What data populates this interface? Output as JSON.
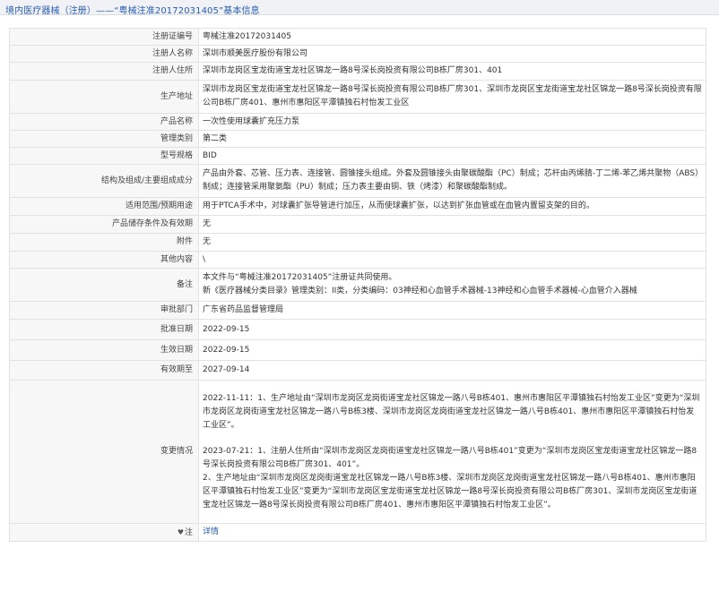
{
  "header": {
    "title": "境内医疗器械（注册）——“粤械注准20172031405”基本信息"
  },
  "rows": [
    {
      "label": "注册证编号",
      "value": "粤械注准20172031405"
    },
    {
      "label": "注册人名称",
      "value": "深圳市顺美医疗股份有限公司"
    },
    {
      "label": "注册人住所",
      "value": "深圳市龙岗区宝龙街道宝龙社区锦龙一路8号深长岗投资有限公司B栋厂房301、401"
    },
    {
      "label": "生产地址",
      "value": "深圳市龙岗区宝龙街道宝龙社区锦龙一路8号深长岗投资有限公司B栋厂房301、深圳市龙岗区宝龙街道宝龙社区锦龙一路8号深长岗投资有限公司B栋厂房401、惠州市惠阳区平潭镇独石村怡发工业区"
    },
    {
      "label": "产品名称",
      "value": "一次性使用球囊扩充压力泵"
    },
    {
      "label": "管理类别",
      "value": "第二类"
    },
    {
      "label": "型号规格",
      "value": "BID"
    },
    {
      "label": "结构及组成/主要组成成分",
      "value": "产品由外套、芯管、压力表、连接管、圆锥接头组成。外套及圆锥接头由聚碳酸酯（PC）制成；芯杆由丙烯腈-丁二烯-苯乙烯共聚物（ABS）制成；连接管采用聚氨酯（PU）制成；压力表主要由铜、铁（烤漆）和聚碳酸酯制成。"
    },
    {
      "label": "适用范围/预期用途",
      "value": "用于PTCA手术中，对球囊扩张导管进行加压，从而使球囊扩张，以达到扩张血管或在血管内置留支架的目的。"
    },
    {
      "label": "产品储存条件及有效期",
      "value": "无"
    },
    {
      "label": "附件",
      "value": "无"
    },
    {
      "label": "其他内容",
      "value": "\\"
    }
  ],
  "remarks": {
    "label": "备注",
    "lines": [
      "本文件与“粤械注准20172031405”注册证共同使用。",
      "新《医疗器械分类目录》管理类别：II类，分类编码：03神经和心血管手术器械-13神经和心血管手术器械-心血管介入器械"
    ]
  },
  "rows2": [
    {
      "label": "审批部门",
      "value": "广东省药品监督管理局"
    },
    {
      "label": "批准日期",
      "value": "2022-09-15"
    },
    {
      "label": "生效日期",
      "value": "2022-09-15"
    },
    {
      "label": "有效期至",
      "value": "2027-09-14"
    }
  ],
  "changes": {
    "label": "变更情况",
    "entries": [
      "2022-11-11：1、生产地址由“深圳市龙岗区龙岗街道宝龙社区锦龙一路八号B栋401、惠州市惠阳区平潭镇独石村怡发工业区”变更为“深圳市龙岗区龙岗街道宝龙社区锦龙一路八号B栋3楼、深圳市龙岗区龙岗街道宝龙社区锦龙一路八号B栋401、惠州市惠阳区平潭镇独石村怡发工业区”。",
      "2023-07-21：1、注册人住所由“深圳市龙岗区龙岗街道宝龙社区锦龙一路八号B栋401”变更为“深圳市龙岗区宝龙街道宝龙社区锦龙一路8号深长岗投资有限公司B栋厂房301、401”。",
      "2、生产地址由“深圳市龙岗区龙岗街道宝龙社区锦龙一路八号B栋3楼、深圳市龙岗区龙岗街道宝龙社区锦龙一路八号B栋401、惠州市惠阳区平潭镇独石村怡发工业区”变更为“深圳市龙岗区宝龙街道宝龙社区锦龙一路8号深长岗投资有限公司B栋厂房301、深圳市龙岗区宝龙街道宝龙社区锦龙一路8号深长岗投资有限公司B栋厂房401、惠州市惠阳区平潭镇独石村怡发工业区”。"
    ]
  },
  "footer": {
    "label": "注",
    "link_text": "详情"
  }
}
